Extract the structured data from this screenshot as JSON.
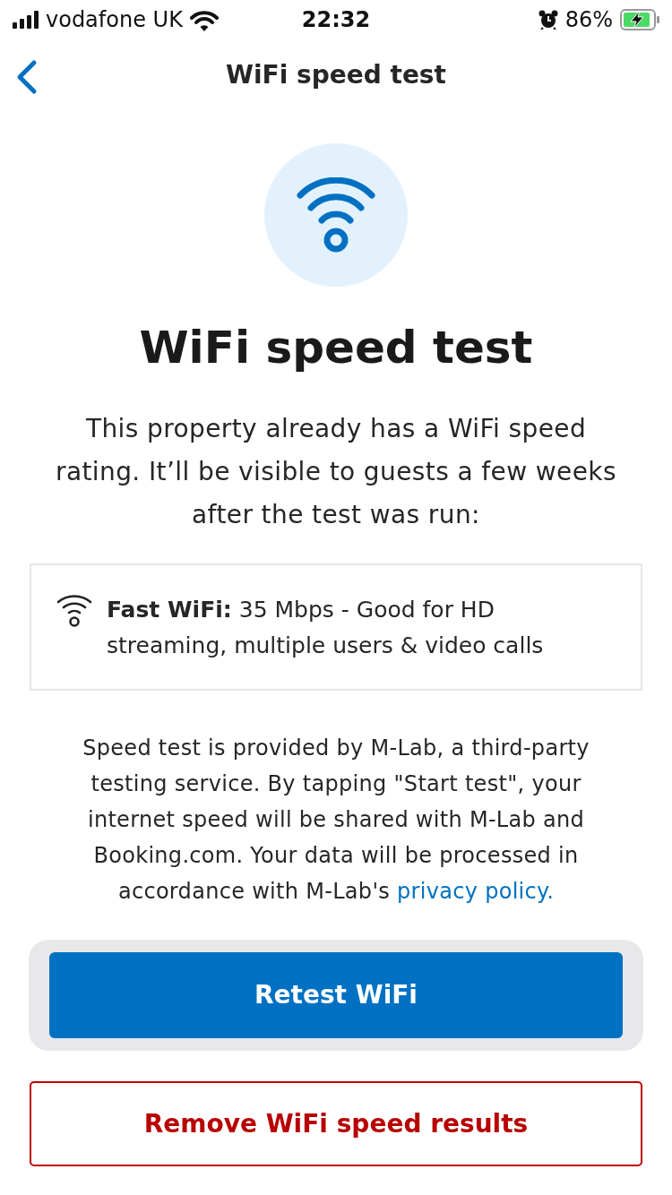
{
  "status_bar": {
    "carrier": "vodafone UK",
    "time": "22:32",
    "battery_percent": "86%",
    "charging": true
  },
  "nav": {
    "title": "WiFi speed test"
  },
  "hero": {
    "title": "WiFi speed test",
    "description": "This property already has a WiFi speed rating. It’ll be visible to guests a few weeks after the test was run:"
  },
  "rating": {
    "text": "**Fast WiFi:** 35 Mbps - Good for HD streaming, multiple users & video calls"
  },
  "disclaimer": {
    "text": "Speed test is provided by M-Lab, a third-party testing service. By tapping \"Start test\", your internet speed will be shared with M-Lab and Booking.com. Your data will be processed in accordance with M-Lab's",
    "link": "privacy policy."
  },
  "buttons": [
    {
      "label": "Retest WiFi",
      "kind": "primary"
    },
    {
      "label": "Remove WiFi speed results",
      "kind": "danger"
    }
  ]
}
